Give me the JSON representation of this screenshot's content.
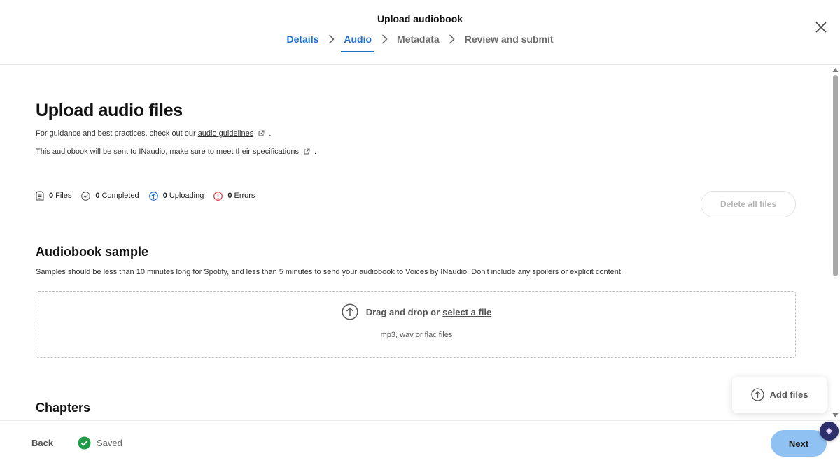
{
  "header": {
    "title": "Upload audiobook",
    "steps": [
      {
        "label": "Details",
        "state": "done"
      },
      {
        "label": "Audio",
        "state": "active"
      },
      {
        "label": "Metadata",
        "state": "pending"
      },
      {
        "label": "Review and submit",
        "state": "pending"
      }
    ],
    "close_icon": "close-icon"
  },
  "main": {
    "title": "Upload audio files",
    "guidance_text": "For guidance and best practices, check out our",
    "guidance_link": "audio guidelines",
    "guidance_end": ".",
    "spec_text": "This audiobook will be sent to INaudio, make sure to meet their",
    "spec_link": "specifications",
    "spec_end": ".",
    "stats": {
      "files_count": "0",
      "files_label": "Files",
      "completed_count": "0",
      "completed_label": "Completed",
      "uploading_count": "0",
      "uploading_label": "Uploading",
      "errors_count": "0",
      "errors_label": "Errors"
    },
    "delete_all_label": "Delete all files",
    "sample": {
      "title": "Audiobook sample",
      "description": "Samples should be less than 10 minutes long for Spotify, and less than 5 minutes to send your audiobook to Voices by INaudio. Don't include any spoilers or explicit content.",
      "drop_text": "Drag and drop or",
      "drop_link": "select a file",
      "hint": "mp3, wav or flac files"
    },
    "chapters_title": "Chapters",
    "add_files_label": "Add files"
  },
  "footer": {
    "back_label": "Back",
    "saved_label": "Saved",
    "next_label": "Next"
  },
  "colors": {
    "accent": "#1e6fc9",
    "next_button": "#8fc1f3",
    "success": "#1f9d48",
    "error": "#d32f2f"
  }
}
